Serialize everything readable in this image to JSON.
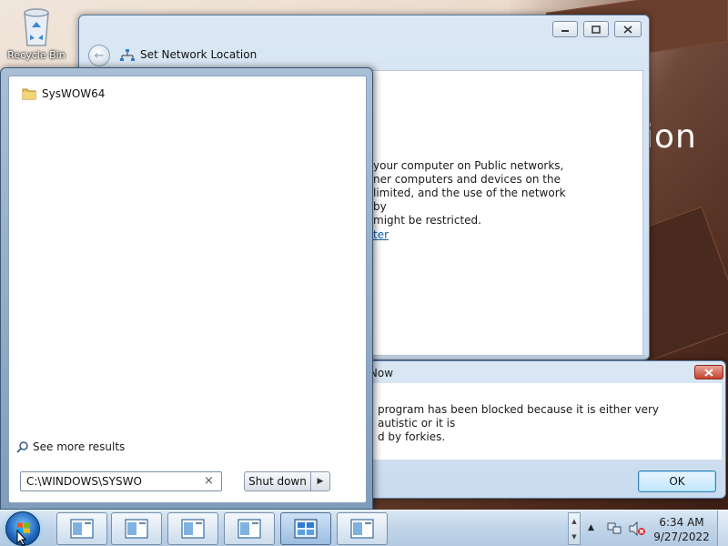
{
  "desktop": {
    "recycle_bin_label": "Recycle Bin",
    "wallpaper_text": "ion"
  },
  "network_window": {
    "title": "Set Network Location",
    "description": "your computer on Public networks, ner computers and devices on the limited, and the use of the network by might be restricted.",
    "description_lines": [
      "your computer on Public networks,",
      "ner computers and devices on the",
      "limited, and the use of the network by",
      " might be restricted."
    ],
    "link_text": "ter"
  },
  "dialog": {
    "title": "y Now",
    "message_lines": [
      "program has been blocked because it is either very autistic or it is",
      "d by forkies."
    ],
    "ok_label": "OK",
    "close_label": "x"
  },
  "start_menu": {
    "results": [
      {
        "label": "SysWOW64",
        "icon": "folder-icon"
      }
    ],
    "see_more_label": "See more results",
    "search_value": "C:\\WINDOWS\\SYSWO",
    "search_clear": "×",
    "shutdown_label": "Shut down"
  },
  "taskbar": {
    "buttons": [
      {
        "icon": "document-window-icon",
        "active": false
      },
      {
        "icon": "document-window-icon",
        "active": false
      },
      {
        "icon": "document-window-icon",
        "active": false
      },
      {
        "icon": "document-window-icon",
        "active": false
      },
      {
        "icon": "network-window-icon",
        "active": true
      },
      {
        "icon": "document-window-icon",
        "active": false
      }
    ],
    "clock": {
      "time": "6:34 AM",
      "date": "9/27/2022"
    }
  },
  "colors": {
    "accent": "#1060b0",
    "dialog_close": "#c8412d",
    "taskbar": "#c2d6ea"
  }
}
